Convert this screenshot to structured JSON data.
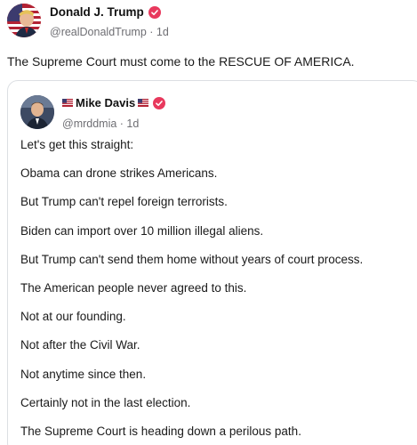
{
  "main_post": {
    "author_name": "Donald J. Trump",
    "handle_time": "@realDonaldTrump · 1d",
    "text": "The Supreme Court must come to the RESCUE OF AMERICA."
  },
  "quoted_post": {
    "author_name": "Mike Davis",
    "handle_time": "@mrddmia · 1d",
    "lines": [
      "Let's get this straight:",
      "Obama can drone strikes Americans.",
      "But Trump can't repel foreign terrorists.",
      "Biden can import over 10 million illegal aliens.",
      "But Trump can't send them home without years of court process.",
      "The American people never agreed to this.",
      "Not at our founding.",
      "Not after the Civil War.",
      "Not anytime since then.",
      "Certainly not in the last election.",
      "The Supreme Court is heading down a perilous path."
    ]
  },
  "icons": {
    "verified": "verified-badge-icon",
    "flag": "us-flag-icon"
  },
  "colors": {
    "verified_badge": "#e8395d",
    "handle_text": "#6e6e73",
    "card_border": "#dcdfe3"
  }
}
